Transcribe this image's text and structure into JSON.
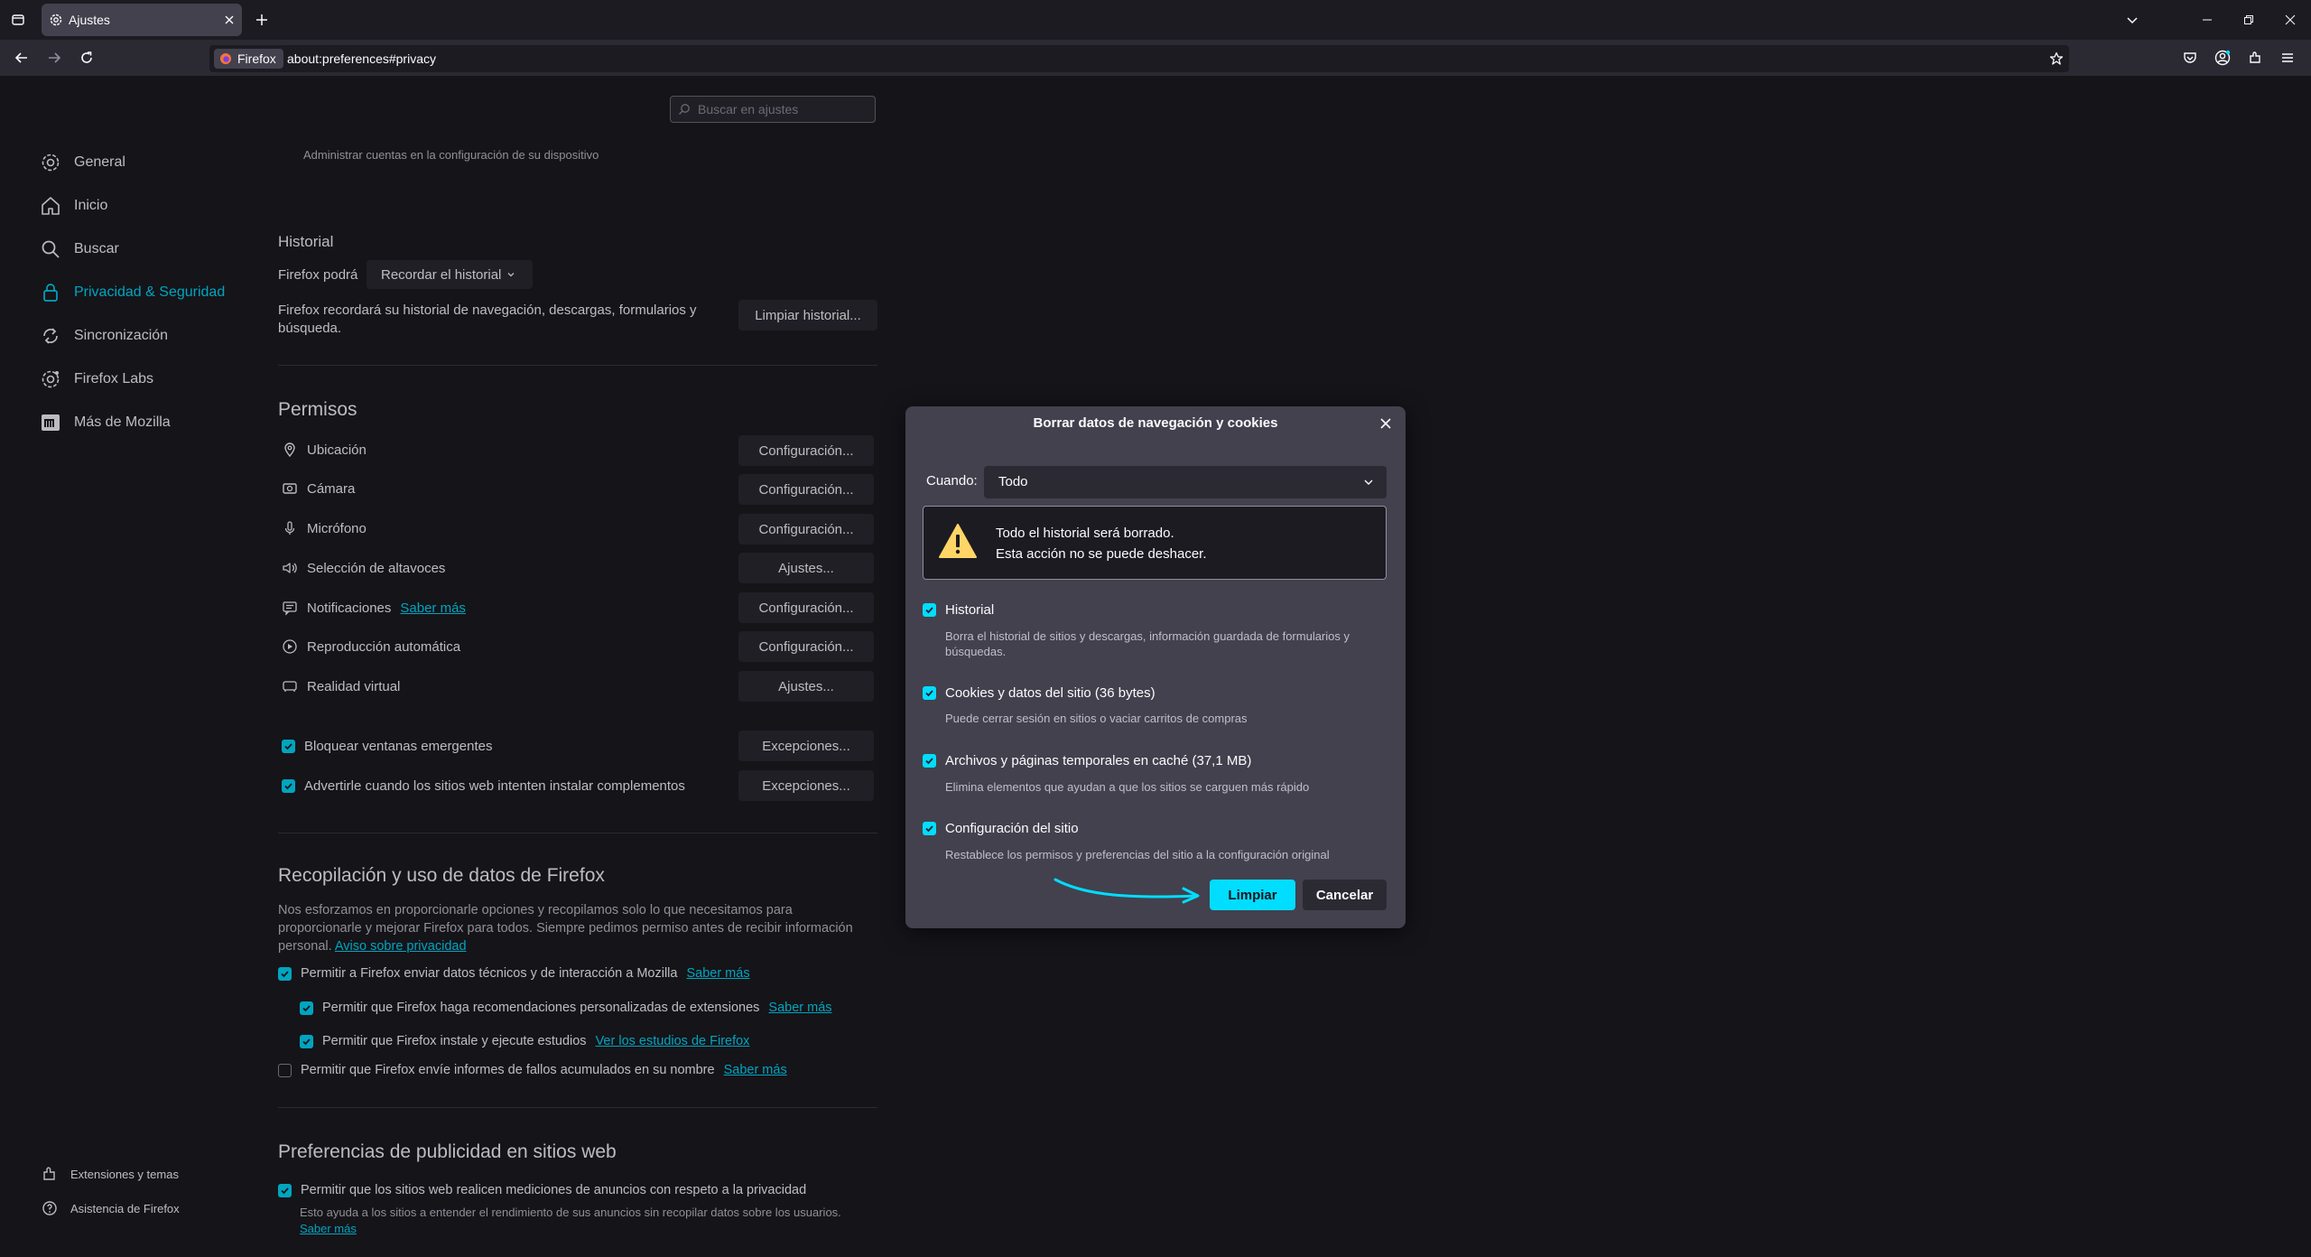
{
  "browser": {
    "tab_title": "Ajustes",
    "identity_label": "Firefox",
    "url": "about:preferences#privacy"
  },
  "search": {
    "placeholder": "Buscar en ajustes"
  },
  "sidebar": {
    "items": [
      {
        "label": "General",
        "icon": "gear-icon"
      },
      {
        "label": "Inicio",
        "icon": "home-icon"
      },
      {
        "label": "Buscar",
        "icon": "search-icon"
      },
      {
        "label": "Privacidad & Seguridad",
        "icon": "lock-icon"
      },
      {
        "label": "Sincronización",
        "icon": "sync-icon"
      },
      {
        "label": "Firefox Labs",
        "icon": "labs-icon"
      },
      {
        "label": "Más de Mozilla",
        "icon": "mozilla-icon"
      }
    ],
    "footer": [
      {
        "label": "Extensiones y temas",
        "icon": "puzzle-icon"
      },
      {
        "label": "Asistencia de Firefox",
        "icon": "help-icon"
      }
    ]
  },
  "main": {
    "accounts_note": "Administrar cuentas en la configuración de su dispositivo",
    "history": {
      "heading": "Historial",
      "will_label": "Firefox podrá",
      "mode": "Recordar el historial",
      "desc": "Firefox recordará su historial de navegación, descargas, formularios y búsqueda.",
      "clear_button": "Limpiar historial..."
    },
    "permissions": {
      "heading": "Permisos",
      "items": [
        {
          "label": "Ubicación",
          "button": "Configuración...",
          "icon": "location-icon"
        },
        {
          "label": "Cámara",
          "button": "Configuración...",
          "icon": "camera-icon"
        },
        {
          "label": "Micrófono",
          "button": "Configuración...",
          "icon": "microphone-icon"
        },
        {
          "label": "Selección de altavoces",
          "button": "Ajustes...",
          "icon": "speaker-icon"
        },
        {
          "label": "Notificaciones",
          "button": "Configuración...",
          "icon": "notification-icon",
          "link": "Saber más"
        },
        {
          "label": "Reproducción automática",
          "button": "Configuración...",
          "icon": "autoplay-icon"
        },
        {
          "label": "Realidad virtual",
          "button": "Ajustes...",
          "icon": "vr-icon"
        }
      ],
      "checks": [
        {
          "label": "Bloquear ventanas emergentes",
          "button": "Excepciones...",
          "checked": true
        },
        {
          "label": "Advertirle cuando los sitios web intenten instalar complementos",
          "button": "Excepciones...",
          "checked": true
        }
      ]
    },
    "data_collection": {
      "heading": "Recopilación y uso de datos de Firefox",
      "desc_line1": "Nos esforzamos en proporcionarle opciones y recopilamos solo lo que necesitamos para",
      "desc_line2": "proporcionarle y mejorar Firefox para todos. Siempre pedimos permiso antes de recibir información",
      "desc_line3": "personal.",
      "privacy_link": "Aviso sobre privacidad",
      "checks": [
        {
          "label": "Permitir a Firefox enviar datos técnicos y de interacción a Mozilla",
          "link": "Saber más",
          "checked": true
        },
        {
          "label": "Permitir que Firefox haga recomendaciones personalizadas de extensiones",
          "link": "Saber más",
          "checked": true
        },
        {
          "label": "Permitir que Firefox instale y ejecute estudios",
          "link": "Ver los estudios de Firefox",
          "checked": true
        },
        {
          "label": "Permitir que Firefox envíe informes de fallos acumulados en su nombre",
          "link": "Saber más",
          "checked": false
        }
      ]
    },
    "ads": {
      "heading": "Preferencias de publicidad en sitios web",
      "check_label": "Permitir que los sitios web realicen mediciones de anuncios con respeto a la privacidad",
      "desc": "Esto ayuda a los sitios a entender el rendimiento de sus anuncios sin recopilar datos sobre los usuarios.",
      "link": "Saber más"
    }
  },
  "dialog": {
    "title": "Borrar datos de navegación y cookies",
    "when_label": "Cuando:",
    "when_value": "Todo",
    "warning_line1": "Todo el historial será borrado.",
    "warning_line2": "Esta acción no se puede deshacer.",
    "options": [
      {
        "label": "Historial",
        "desc1": "Borra el historial de sitios y descargas, información guardada de formularios y",
        "desc2": "búsquedas.",
        "checked": true
      },
      {
        "label": "Cookies y datos del sitio (36 bytes)",
        "desc1": "Puede cerrar sesión en sitios o vaciar carritos de compras",
        "desc2": "",
        "checked": true
      },
      {
        "label": "Archivos y páginas temporales en caché (37,1 MB)",
        "desc1": "Elimina elementos que ayudan a que los sitios se carguen más rápido",
        "desc2": "",
        "checked": true
      },
      {
        "label": "Configuración del sitio",
        "desc1": "Restablece los permisos y preferencias del sitio a la configuración original",
        "desc2": "",
        "checked": true
      }
    ],
    "clear_button": "Limpiar",
    "cancel_button": "Cancelar"
  },
  "colors": {
    "accent": "#00ddff",
    "background": "#1c1b22",
    "toolbar": "#2b2a33",
    "dialog": "#42414d"
  }
}
